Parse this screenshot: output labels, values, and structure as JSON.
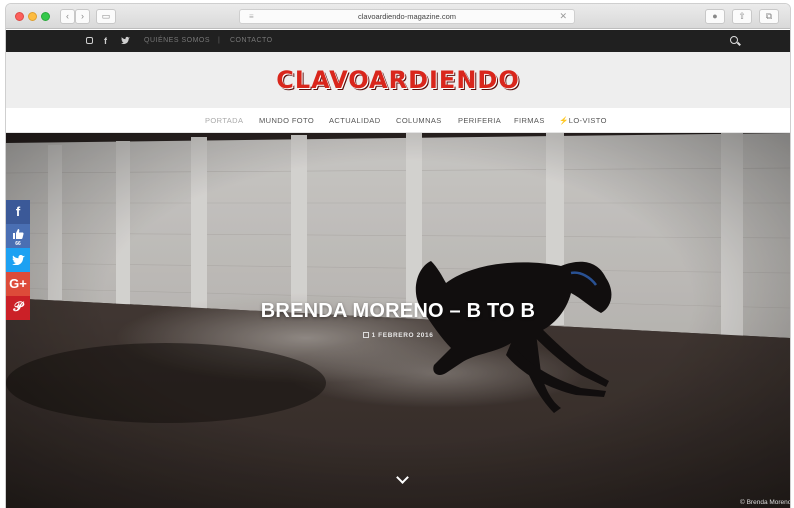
{
  "browser": {
    "url": "clavoardiendo-magazine.com",
    "reader_icon": "reader-icon",
    "close_icon": "close-icon"
  },
  "topbar": {
    "social_icons": [
      "instagram-icon",
      "facebook-icon",
      "twitter-icon"
    ],
    "facebook_glyph": "f",
    "links": [
      "QUIÉNES SOMOS",
      "CONTACTO"
    ],
    "separator": "|"
  },
  "header": {
    "logo_text": "CLAVOARDIENDO",
    "logo_color": "#d9261c"
  },
  "nav": {
    "items": [
      "PORTADA",
      "MUNDO FOTO",
      "ACTUALIDAD",
      "COLUMNAS",
      "PERIFERIA",
      "FIRMAS",
      "LO-VISTO"
    ],
    "active_item": "PORTADA",
    "lo_visto_icon": "bolt-icon"
  },
  "hero": {
    "title": "BRENDA MORENO – B TO B",
    "date": "1 FEBRERO 2016",
    "credit": "© Brenda Moreno",
    "scroll_icon": "chevron-down-icon"
  },
  "share_bar": {
    "buttons": [
      {
        "name": "facebook",
        "glyph": "f",
        "color": "#3b5998"
      },
      {
        "name": "like",
        "glyph": "👍",
        "count": "66",
        "color": "#4a6fb3"
      },
      {
        "name": "twitter",
        "glyph": "🐦",
        "color": "#1da1f2"
      },
      {
        "name": "google-plus",
        "glyph": "G+",
        "color": "#dd4b39"
      },
      {
        "name": "pinterest",
        "glyph": "P",
        "color": "#cb2027"
      }
    ]
  }
}
